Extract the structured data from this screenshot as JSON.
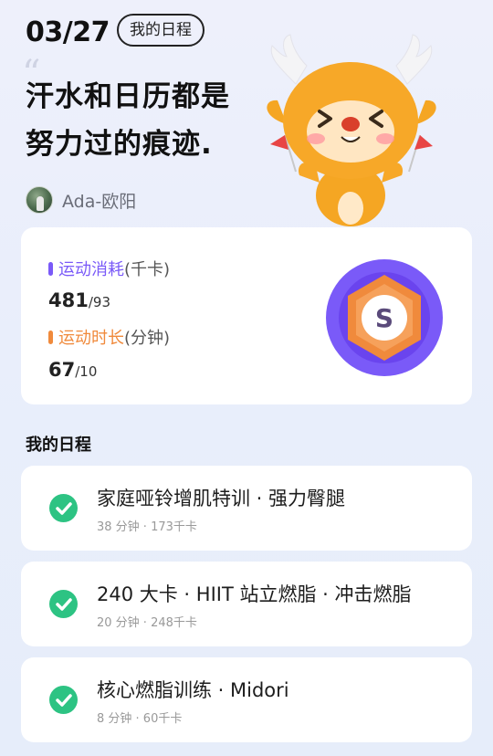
{
  "header": {
    "date": "03/27",
    "tag": "我的日程"
  },
  "slogan": {
    "line1": "汗水和日历都是",
    "line2": "努力过的痕迹."
  },
  "author": {
    "name": "Ada-欧阳"
  },
  "stats": {
    "calories": {
      "label": "运动消耗",
      "unit": "(千卡)",
      "value": "481",
      "target": "/93",
      "color": "#7a5af8"
    },
    "duration": {
      "label": "运动时长",
      "unit": "(分钟)",
      "value": "67",
      "target": "/10",
      "color": "#f08a3c"
    },
    "badge_letter": "S"
  },
  "schedule": {
    "title": "我的日程",
    "items": [
      {
        "title": "家庭哑铃增肌特训 · 强力臀腿",
        "meta": "38 分钟 · 173千卡"
      },
      {
        "title": "240 大卡 · HIIT 站立燃脂 · 冲击燃脂",
        "meta": "20 分钟 · 248千卡"
      },
      {
        "title": "核心燃脂训练 · Midori",
        "meta": "8 分钟 · 60千卡"
      }
    ]
  },
  "colors": {
    "check": "#2dc383",
    "badge_outer": "#7a5af8",
    "badge_inner": "#f08a3c"
  }
}
